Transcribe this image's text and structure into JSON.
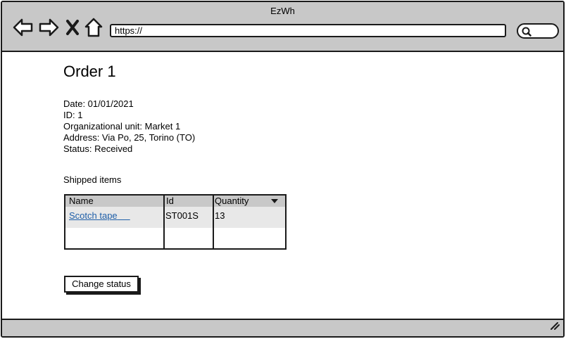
{
  "window": {
    "title": "EzWh"
  },
  "toolbar": {
    "back_icon": "arrow-left-icon",
    "forward_icon": "arrow-right-icon",
    "stop_icon": "close-icon",
    "home_icon": "home-icon",
    "search_icon": "search-icon"
  },
  "address_bar": {
    "value": "https://"
  },
  "page": {
    "title": "Order 1",
    "details": {
      "date": "Date: 01/01/2021",
      "id": "ID: 1",
      "org_unit": "Organizational unit: Market 1",
      "address": "Address: Via Po, 25, Torino (TO)",
      "status": "Status: Received"
    },
    "shipped_label": "Shipped items",
    "table": {
      "columns": [
        "Name",
        "Id",
        "Quantity"
      ],
      "rows": [
        {
          "name": "Scotch tape",
          "id": "ST001S",
          "quantity": "13"
        }
      ]
    },
    "change_status_label": "Change status"
  },
  "colors": {
    "chrome": "#c8c8c8",
    "border": "#1a1a1a",
    "link": "#1f5fa8",
    "row_alt": "#e8e8e8"
  }
}
